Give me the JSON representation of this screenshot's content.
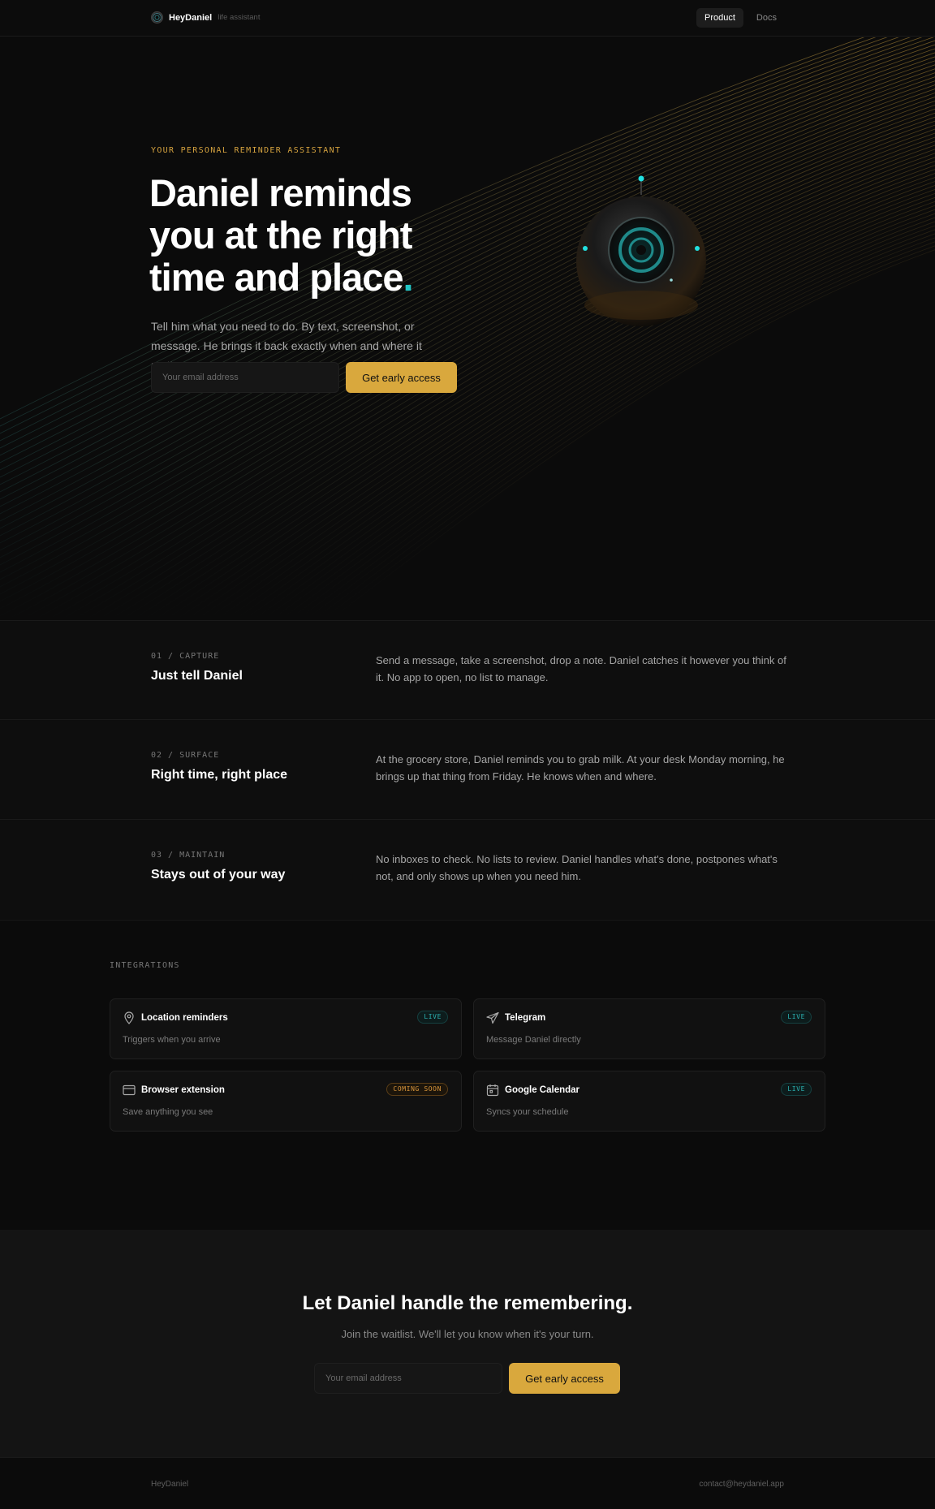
{
  "nav": {
    "brand_name": "HeyDaniel",
    "brand_tag": "life assistant",
    "links": [
      "Product",
      "Docs"
    ]
  },
  "hero": {
    "eyebrow": "YOUR PERSONAL REMINDER ASSISTANT",
    "title_line1": "Daniel reminds",
    "title_line2": "you at the right",
    "title_line3": "time and place",
    "title_dot": ".",
    "subtitle": "Tell him what you need to do. By text, screenshot, or message. He brings it back exactly when and where it matters.",
    "email_placeholder": "Your email address",
    "cta_label": "Get early access"
  },
  "steps": [
    {
      "num": "01 / CAPTURE",
      "title": "Just tell Daniel",
      "text": "Send a message, take a screenshot, drop a note. Daniel catches it however you think of it. No app to open, no list to manage."
    },
    {
      "num": "02 / SURFACE",
      "title": "Right time, right place",
      "text": "At the grocery store, Daniel reminds you to grab milk. At your desk Monday morning, he brings up that thing from Friday. He knows when and where."
    },
    {
      "num": "03 / MAINTAIN",
      "title": "Stays out of your way",
      "text": "No inboxes to check. No lists to review. Daniel handles what's done, postpones what's not, and only shows up when you need him."
    }
  ],
  "integrations": {
    "label": "INTEGRATIONS",
    "cards": [
      {
        "icon": "map-pin-icon",
        "title": "Location reminders",
        "desc": "Triggers when you arrive",
        "badge": "LIVE"
      },
      {
        "icon": "paper-plane-icon",
        "title": "Telegram",
        "desc": "Message Daniel directly",
        "badge": "LIVE"
      },
      {
        "icon": "browser-window-icon",
        "title": "Browser extension",
        "desc": "Save anything you see",
        "badge": "COMING SOON"
      },
      {
        "icon": "calendar-icon",
        "title": "Google Calendar",
        "desc": "Syncs your schedule",
        "badge": "LIVE"
      }
    ]
  },
  "cta": {
    "title": "Let Daniel handle the remembering.",
    "subtitle": "Join the waitlist. We'll let you know when it's your turn.",
    "email_placeholder": "Your email address",
    "button_label": "Get early access"
  },
  "footer": {
    "brand": "HeyDaniel",
    "email": "contact@heydaniel.app"
  },
  "colors": {
    "accent": "#d9a83d",
    "teal": "#22c7c7",
    "background": "#0b0b0b"
  }
}
